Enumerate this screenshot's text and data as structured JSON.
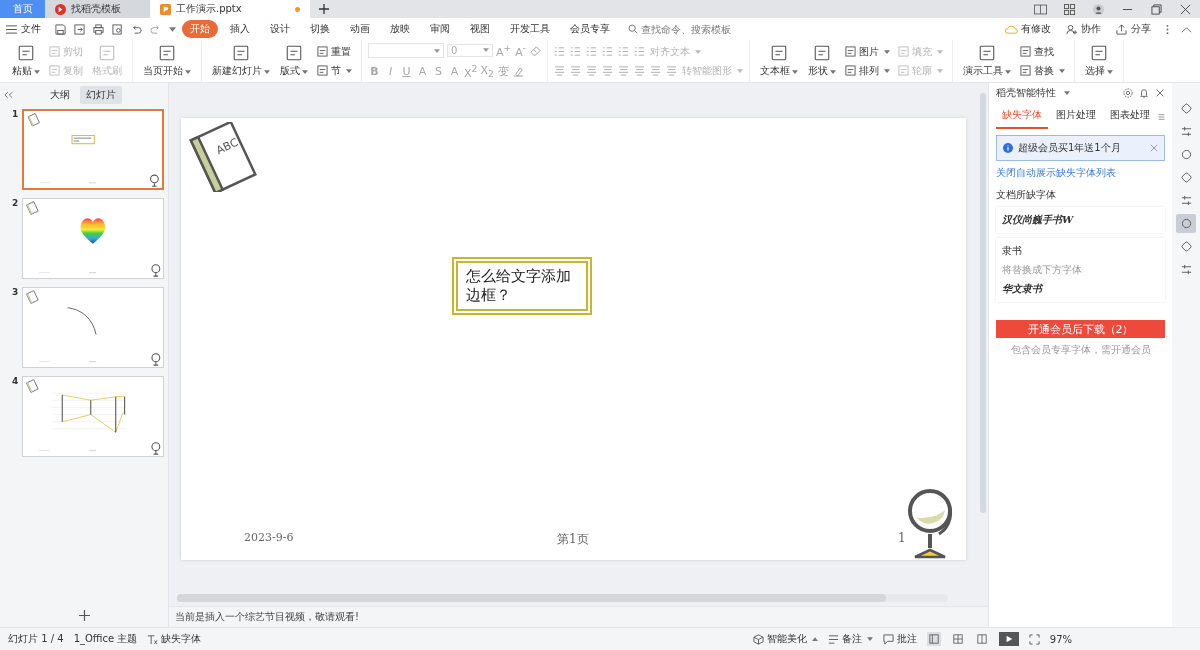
{
  "tabs": [
    {
      "label": "首页",
      "kind": "home",
      "selected": false,
      "unsaved": false
    },
    {
      "label": "找稻壳模板",
      "kind": "template",
      "selected": false,
      "unsaved": false
    },
    {
      "label": "工作演示.pptx",
      "kind": "document",
      "selected": true,
      "unsaved": true
    }
  ],
  "menu": {
    "file": "文件",
    "tabs": [
      {
        "label": "开始",
        "selected": true
      },
      {
        "label": "插入",
        "selected": false
      },
      {
        "label": "设计",
        "selected": false
      },
      {
        "label": "切换",
        "selected": false
      },
      {
        "label": "动画",
        "selected": false
      },
      {
        "label": "放映",
        "selected": false
      },
      {
        "label": "审阅",
        "selected": false
      },
      {
        "label": "视图",
        "selected": false
      },
      {
        "label": "开发工具",
        "selected": false
      },
      {
        "label": "会员专享",
        "selected": false
      }
    ],
    "search": {
      "placeholder": "查找命令、搜索模板"
    },
    "actions": [
      "有修改",
      "协作",
      "分享"
    ]
  },
  "ribbon": {
    "groups": [
      {
        "kind": "tools",
        "columns": [
          {
            "kind": "large",
            "items": [
              {
                "label": "粘贴",
                "dropdown": true,
                "disabled": false
              }
            ]
          },
          {
            "kind": "small",
            "items": [
              {
                "label": "剪切",
                "dropdown": false,
                "disabled": true
              },
              {
                "label": "复制",
                "dropdown": false,
                "disabled": true
              }
            ]
          },
          {
            "kind": "large",
            "items": [
              {
                "label": "格式刷",
                "dropdown": false,
                "disabled": true
              }
            ]
          }
        ]
      },
      {
        "kind": "tools",
        "columns": [
          {
            "kind": "large",
            "items": [
              {
                "label": "当页开始",
                "dropdown": true,
                "disabled": false
              }
            ]
          }
        ]
      },
      {
        "kind": "tools",
        "columns": [
          {
            "kind": "large",
            "items": [
              {
                "label": "新建幻灯片",
                "dropdown": true,
                "disabled": false
              }
            ]
          },
          {
            "kind": "large",
            "items": [
              {
                "label": "版式",
                "dropdown": true,
                "disabled": false
              }
            ]
          },
          {
            "kind": "small",
            "items": [
              {
                "label": "重置",
                "dropdown": false,
                "disabled": false
              },
              {
                "label": "节",
                "dropdown": true,
                "disabled": false
              }
            ]
          }
        ]
      },
      {
        "kind": "font",
        "size": "0",
        "size_buttons": [
          "A$^{+}$",
          "A$^{-}$"
        ],
        "styles": [
          "B",
          "I",
          "U",
          "A",
          "S",
          "A",
          "X$^{2}$",
          "X$_{2}$",
          "变"
        ]
      },
      {
        "kind": "paragraph",
        "items": [
          {
            "label": "对齐文本",
            "dropdown": true,
            "disabled": true
          },
          {
            "label": "转智能图形",
            "dropdown": true,
            "disabled": true
          }
        ]
      },
      {
        "kind": "tools",
        "columns": [
          {
            "kind": "large",
            "items": [
              {
                "label": "文本框",
                "dropdown": true,
                "disabled": false
              }
            ]
          },
          {
            "kind": "large",
            "items": [
              {
                "label": "形状",
                "dropdown": true,
                "disabled": false
              }
            ]
          },
          {
            "kind": "small",
            "items": [
              {
                "label": "图片",
                "dropdown": true,
                "disabled": false
              },
              {
                "label": "排列",
                "dropdown": true,
                "disabled": false
              }
            ]
          },
          {
            "kind": "small",
            "items": [
              {
                "label": "填充",
                "dropdown": true,
                "disabled": true
              },
              {
                "label": "轮廓",
                "dropdown": true,
                "disabled": true
              }
            ]
          }
        ]
      },
      {
        "kind": "tools",
        "columns": [
          {
            "kind": "large",
            "items": [
              {
                "label": "演示工具",
                "dropdown": true,
                "disabled": false
              }
            ]
          },
          {
            "kind": "small",
            "items": [
              {
                "label": "查找",
                "dropdown": false,
                "disabled": false
              },
              {
                "label": "替换",
                "dropdown": true,
                "disabled": false
              }
            ]
          }
        ]
      },
      {
        "kind": "tools",
        "columns": [
          {
            "kind": "large",
            "items": [
              {
                "label": "选择",
                "dropdown": true,
                "disabled": false
              }
            ]
          }
        ]
      }
    ]
  },
  "slide_panel": {
    "tabs": [
      {
        "label": "大纲",
        "selected": false
      },
      {
        "label": "幻灯片",
        "selected": true
      }
    ],
    "slides": [
      {
        "number": "1",
        "kind": "title",
        "selected": true
      },
      {
        "number": "2",
        "kind": "heart",
        "selected": false
      },
      {
        "number": "3",
        "kind": "arc",
        "selected": false
      },
      {
        "number": "4",
        "kind": "chart",
        "selected": false
      }
    ]
  },
  "slide": {
    "badge": "ABC",
    "text": "怎么给文字添加边框？",
    "date": "2023-9-6",
    "footer": "第1页",
    "number": "1"
  },
  "notes": "当前是插入一个综艺节目视频，敬请观看!",
  "task_pane": {
    "title": "稻壳智能特性",
    "tabs": [
      {
        "label": "缺失字体",
        "selected": true
      },
      {
        "label": "图片处理",
        "selected": false
      },
      {
        "label": "图表处理",
        "selected": false
      }
    ],
    "banner": "超级会员买1年送1个月",
    "link": "关闭自动展示缺失字体列表",
    "section": "文档所缺字体",
    "fonts": [
      {
        "kind": "missing",
        "sample": "汉仪尚巍手书W"
      },
      {
        "kind": "replace",
        "name": "隶书",
        "hint": "将替换成下方字体",
        "sample": "华文隶书"
      }
    ],
    "button": "开通会员后下载（2）",
    "note": "包含会员专享字体，需开通会员"
  },
  "side_tools": [
    {
      "selected": false
    },
    {
      "selected": false
    },
    {
      "selected": false
    },
    {
      "selected": false
    },
    {
      "selected": false
    },
    {
      "selected": true
    },
    {
      "selected": false
    },
    {
      "selected": false
    }
  ],
  "status_bar": {
    "slide": "幻灯片 1 / 4",
    "theme": "1_Office 主题",
    "font": "缺失字体",
    "beautify": "智能美化",
    "notes": "备注",
    "comments": "批注",
    "views": [
      {
        "selected": true
      },
      {
        "selected": false
      },
      {
        "selected": false
      }
    ],
    "zoom": "97%"
  }
}
